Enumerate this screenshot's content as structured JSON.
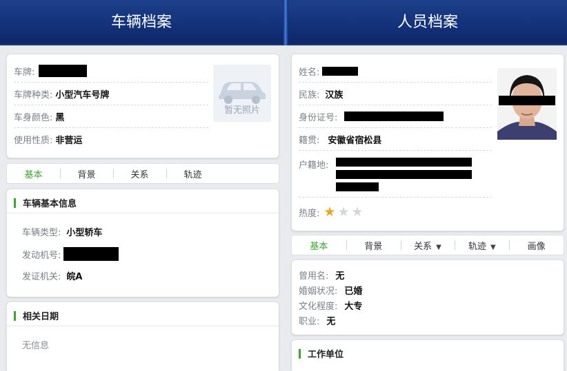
{
  "left_panel": {
    "title": "车辆档案",
    "summary": {
      "plate_label": "车牌:",
      "plate_type_label": "车牌种类:",
      "plate_type_value": "小型汽车号牌",
      "body_color_label": "车身颜色:",
      "body_color_value": "黑",
      "usage_label": "使用性质:",
      "usage_value": "非营运",
      "no_photo_text": "暂无照片"
    },
    "tabs": [
      "基本",
      "背景",
      "关系",
      "轨迹"
    ],
    "basic_info": {
      "title": "车辆基本信息",
      "vehicle_type_label": "车辆类型:",
      "vehicle_type_value": "小型轿车",
      "engine_label": "发动机号:",
      "issuer_label": "发证机关:",
      "issuer_value": "皖A"
    },
    "dates": {
      "title": "相关日期",
      "empty_text": "无信息"
    }
  },
  "right_panel": {
    "title": "人员档案",
    "summary": {
      "name_label": "姓名:",
      "ethnicity_label": "民族:",
      "ethnicity_value": "汉族",
      "id_label": "身份证号:",
      "native_label": "籍贯:",
      "native_value": "安徽省宿松县",
      "household_label": "户籍地:",
      "heat_label": "热度:",
      "heat_rating": 1,
      "heat_max": 3
    },
    "tabs": [
      "基本",
      "背景",
      "关系",
      "轨迹",
      "画像"
    ],
    "basic": {
      "former_name_label": "曾用名:",
      "former_name_value": "无",
      "marital_label": "婚姻状况:",
      "marital_value": "已婚",
      "education_label": "文化程度:",
      "education_value": "大专",
      "job_label": "职业:",
      "job_value": "无"
    },
    "work": {
      "title": "工作单位"
    }
  },
  "colors": {
    "header": "#13327a",
    "accent_green": "#3aa531",
    "star_on": "#f0a419",
    "star_off": "#d3d6da"
  }
}
